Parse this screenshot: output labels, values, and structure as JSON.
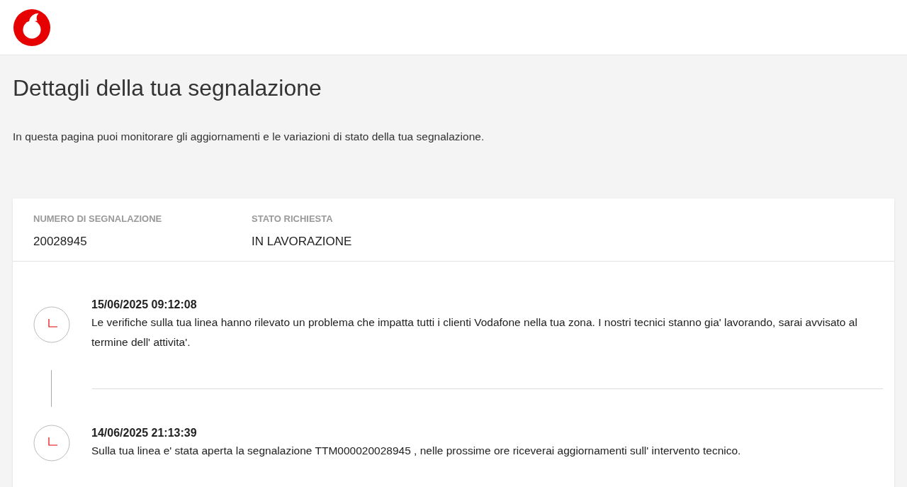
{
  "page": {
    "title": "Dettagli della tua segnalazione",
    "description": "In questa pagina puoi monitorare gli aggiornamenti e le variazioni di stato della tua segnalazione."
  },
  "summary": [
    {
      "label": "NUMERO DI SEGNALAZIONE",
      "value": "20028945"
    },
    {
      "label": "STATO RICHIESTA",
      "value": "IN LAVORAZIONE"
    }
  ],
  "updates": [
    {
      "datetime": "15/06/2025 09:12:08",
      "message": "Le verifiche sulla tua linea hanno rilevato un problema che impatta tutti i clienti Vodafone nella tua zona. I nostri tecnici stanno gia' lavorando, sarai avvisato al termine dell' attivita'."
    },
    {
      "datetime": "14/06/2025 21:13:39",
      "message": "Sulla tua linea e' stata aperta la segnalazione TTM000020028945 , nelle prossime ore riceverai aggiornamenti sull' intervento tecnico."
    }
  ]
}
